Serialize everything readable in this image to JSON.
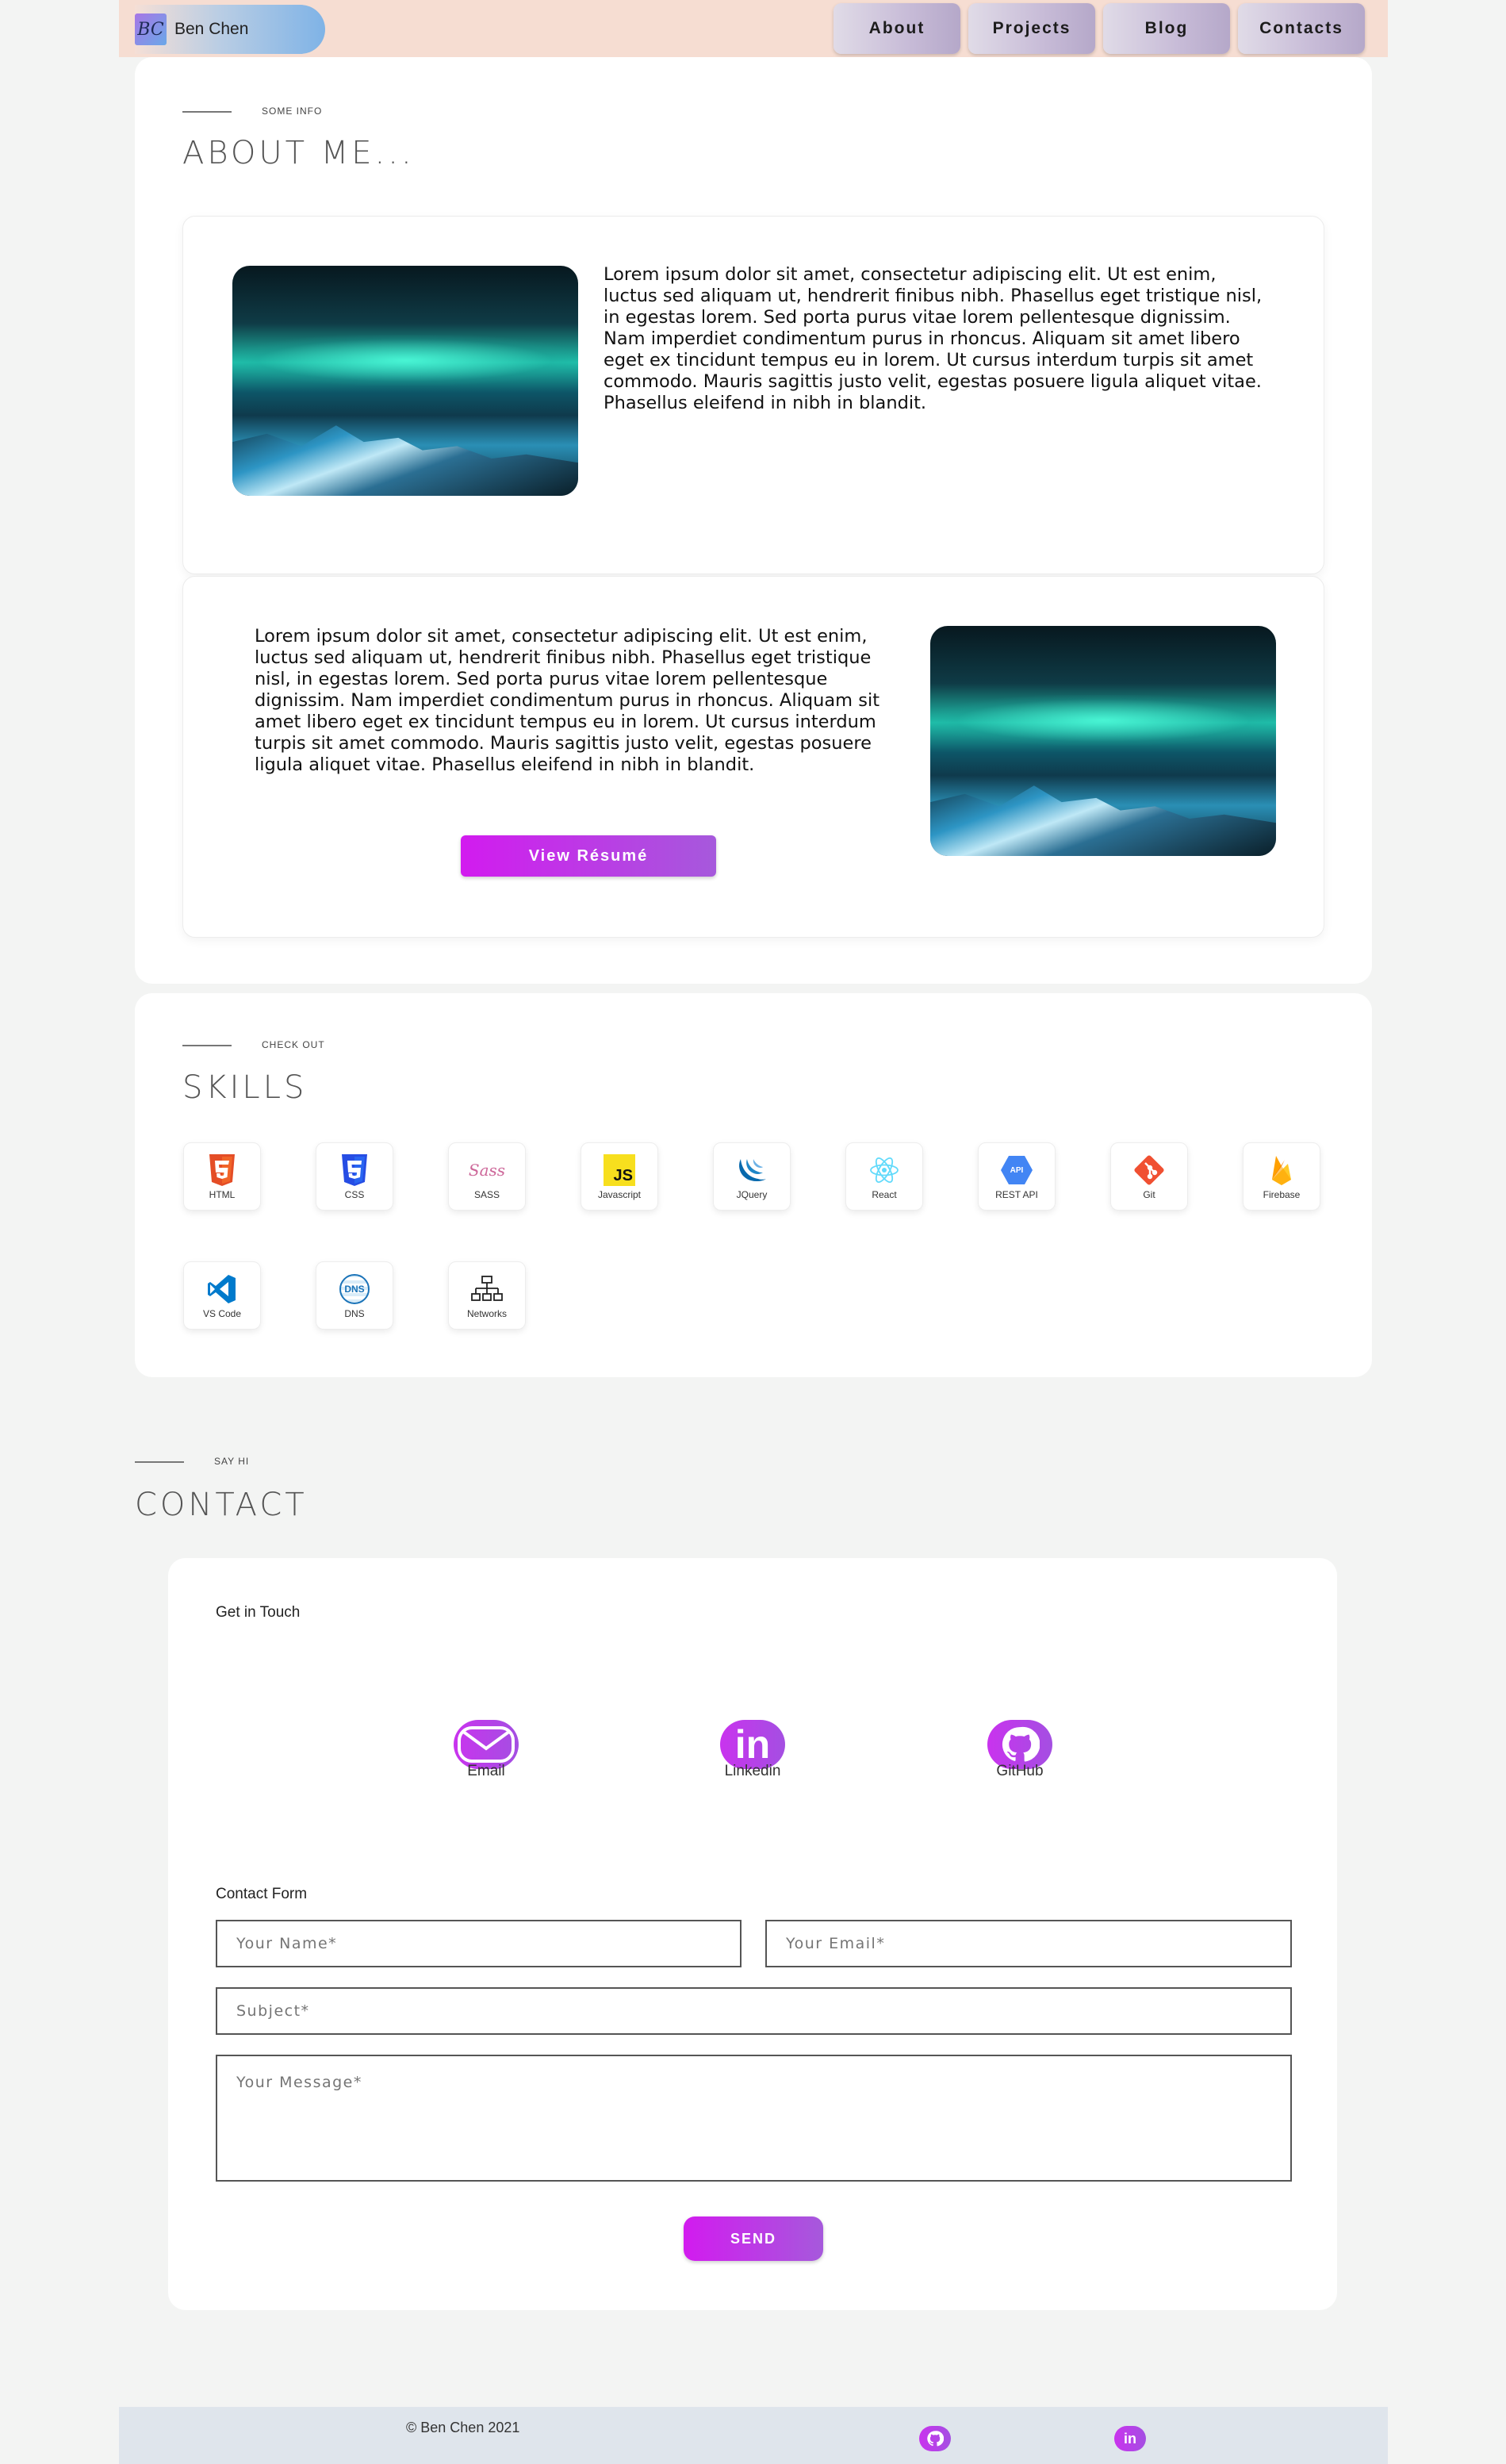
{
  "nav": {
    "brand_name": "Ben Chen",
    "logo_text": "BC",
    "links": [
      "About",
      "Projects",
      "Blog",
      "Contacts"
    ]
  },
  "about": {
    "eyebrow": "SOME INFO",
    "title": "ABOUT ME...",
    "paragraph_1": "Lorem ipsum dolor sit amet, consectetur adipiscing elit. Ut est enim, luctus sed aliquam ut, hendrerit finibus nibh. Phasellus eget tristique nisl, in egestas lorem. Sed porta purus vitae lorem pellentesque dignissim. Nam imperdiet condimentum purus in rhoncus. Aliquam sit amet libero eget ex tincidunt tempus eu in lorem. Ut cursus interdum turpis sit amet commodo. Mauris sagittis justo velit, egestas posuere ligula aliquet vitae. Phasellus eleifend in nibh in blandit.",
    "paragraph_2": "Lorem ipsum dolor sit amet, consectetur adipiscing elit. Ut est enim, luctus sed aliquam ut, hendrerit finibus nibh. Phasellus eget tristique nisl, in egestas lorem. Sed porta purus vitae lorem pellentesque dignissim. Nam imperdiet condimentum purus in rhoncus. Aliquam sit amet libero eget ex tincidunt tempus eu in lorem. Ut cursus interdum turpis sit amet commodo. Mauris sagittis justo velit, egestas posuere ligula aliquet vitae. Phasellus eleifend in nibh in blandit.",
    "resume_button": "View Résumé"
  },
  "skills": {
    "eyebrow": "CHECK OUT",
    "title": "SKILLS",
    "items": [
      {
        "label": "HTML",
        "icon": "html5-icon",
        "color": "#e44d26"
      },
      {
        "label": "CSS",
        "icon": "css3-icon",
        "color": "#264de4"
      },
      {
        "label": "SASS",
        "icon": "sass-icon",
        "color": "#cd6799"
      },
      {
        "label": "Javascript",
        "icon": "javascript-icon",
        "color": "#f7df1e"
      },
      {
        "label": "JQuery",
        "icon": "jquery-icon",
        "color": "#0769ad"
      },
      {
        "label": "React",
        "icon": "react-icon",
        "color": "#61dafb"
      },
      {
        "label": "REST API",
        "icon": "api-icon",
        "color": "#4285f4"
      },
      {
        "label": "Git",
        "icon": "git-icon",
        "color": "#f05032"
      },
      {
        "label": "Firebase",
        "icon": "firebase-icon",
        "color": "#ffca28"
      },
      {
        "label": "VS Code",
        "icon": "vscode-icon",
        "color": "#007acc"
      },
      {
        "label": "DNS",
        "icon": "dns-icon",
        "color": "#1a73b8"
      },
      {
        "label": "Networks",
        "icon": "network-icon",
        "color": "#222222"
      }
    ],
    "js_text": "JS",
    "dns_text": "DNS",
    "api_text": "API",
    "sass_text": "Sass"
  },
  "contact": {
    "eyebrow": "SAY HI",
    "title": "CONTACT",
    "get_in_touch": "Get in Touch",
    "socials": [
      {
        "label": "Email",
        "icon": "mail-icon"
      },
      {
        "label": "Linkedin",
        "icon": "linkedin-icon"
      },
      {
        "label": "GitHub",
        "icon": "github-icon"
      }
    ],
    "linkedin_glyph": "in",
    "form_title": "Contact Form",
    "name_placeholder": "Your Name*",
    "email_placeholder": "Your Email*",
    "subject_placeholder": "Subject*",
    "message_placeholder": "Your Message*",
    "send_button": "SEND"
  },
  "footer": {
    "copyright": "© Ben Chen 2021",
    "linkedin_glyph": "in"
  },
  "colors": {
    "accent_start": "#d21bef",
    "accent_end": "#a659dc",
    "nav_bg": "#f6ddd2",
    "page_bg": "#f3f4f3",
    "footer_bg": "#dfe5ec"
  }
}
